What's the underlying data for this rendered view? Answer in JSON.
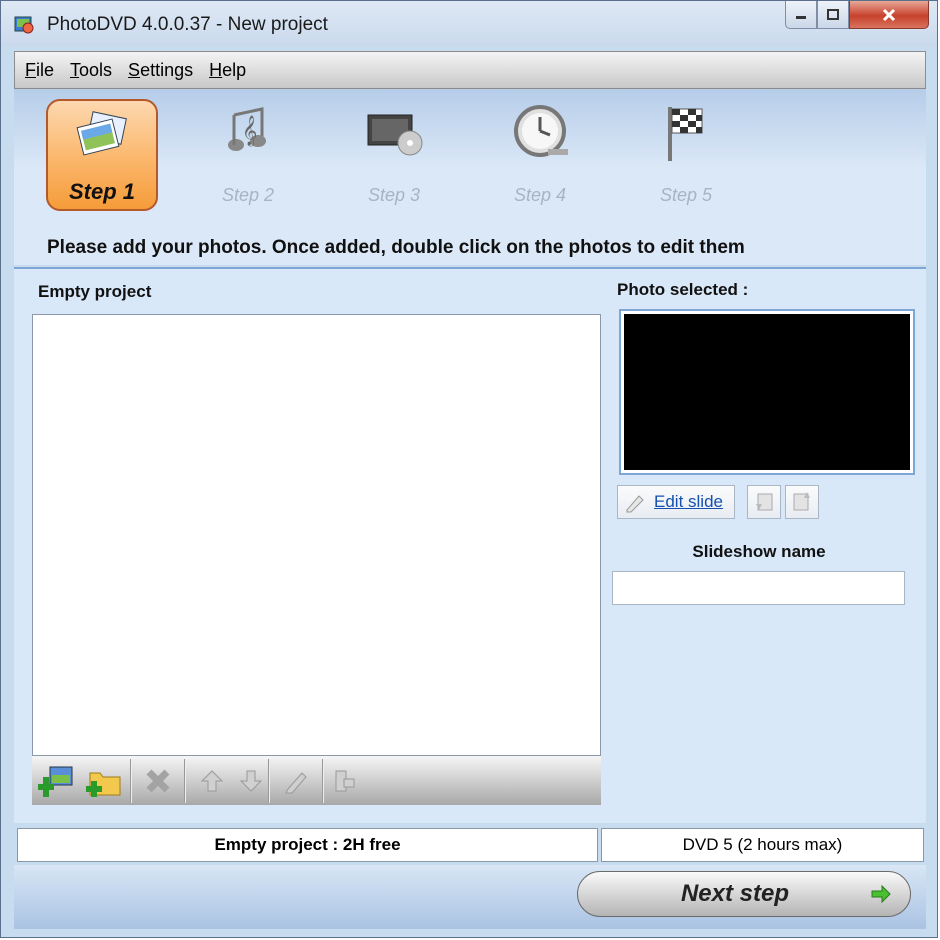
{
  "window": {
    "title": "PhotoDVD 4.0.0.37 - New project",
    "controls": [
      "minimize-icon",
      "maximize-icon",
      "close-icon"
    ]
  },
  "menu": {
    "items": [
      {
        "accel": "F",
        "rest": "ile"
      },
      {
        "accel": "T",
        "rest": "ools"
      },
      {
        "accel": "S",
        "rest": "ettings"
      },
      {
        "accel": "H",
        "rest": "elp"
      }
    ]
  },
  "steps": [
    {
      "label": "Step 1",
      "icon": "photos-icon",
      "active": true
    },
    {
      "label": "Step 2",
      "icon": "music-icon",
      "active": false
    },
    {
      "label": "Step 3",
      "icon": "menu-disc-icon",
      "active": false
    },
    {
      "label": "Step 4",
      "icon": "clock-icon",
      "active": false
    },
    {
      "label": "Step 5",
      "icon": "finish-flag-icon",
      "active": false
    }
  ],
  "instruction": "Please add your photos. Once added, double click on the photos to edit them",
  "project": {
    "title": "Empty project",
    "toolbar": [
      "add-photos-icon",
      "add-folder-icon",
      "delete-icon",
      "move-up-icon",
      "move-down-icon",
      "edit-icon",
      "properties-icon"
    ]
  },
  "selected": {
    "title": "Photo selected :",
    "edit_label": "Edit slide"
  },
  "slideshow": {
    "title": "Slideshow name",
    "value": "",
    "placeholder": ""
  },
  "status": {
    "left": "Empty project : 2H free",
    "right": "DVD 5 (2 hours max)"
  },
  "next_button": "Next step",
  "colors": {
    "accent_orange": "#fbb66a",
    "panel_blue": "#d8e8f8",
    "link_blue": "#1550b0"
  }
}
